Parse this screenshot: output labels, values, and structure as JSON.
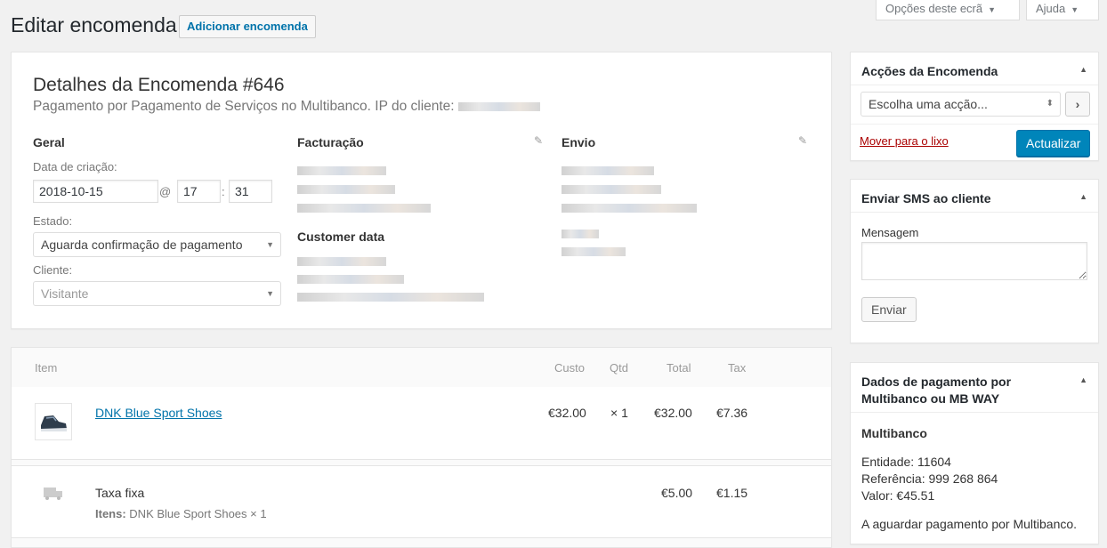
{
  "header": {
    "screen_options": "Opções deste ecrã",
    "help": "Ajuda",
    "title": "Editar encomenda",
    "add_new": "Adicionar encomenda"
  },
  "order": {
    "title": "Detalhes da Encomenda #646",
    "subtitle": "Pagamento por Pagamento de Serviços no Multibanco. IP do cliente:",
    "general": {
      "heading": "Geral",
      "date_label": "Data de criação:",
      "date": "2018-10-15",
      "at": "@",
      "hour": "17",
      "colon": ":",
      "minute": "31",
      "status_label": "Estado:",
      "status": "Aguarda confirmação de pagamento",
      "customer_label": "Cliente:",
      "customer": "Visitante"
    },
    "billing": {
      "heading": "Facturação",
      "customer_data_heading": "Customer data"
    },
    "shipping": {
      "heading": "Envio"
    }
  },
  "items": {
    "headers": {
      "item": "Item",
      "cost": "Custo",
      "qty": "Qtd",
      "total": "Total",
      "tax": "Tax"
    },
    "product": {
      "name": "DNK Blue Sport Shoes",
      "cost": "€32.00",
      "qty": "× 1",
      "total": "€32.00",
      "tax": "€7.36"
    },
    "shipping": {
      "name": "Taxa fixa",
      "items_label": "Itens:",
      "items_value": "DNK Blue Sport Shoes × 1",
      "total": "€5.00",
      "tax": "€1.15"
    }
  },
  "sidebar": {
    "actions": {
      "title": "Acções da Encomenda",
      "select": "Escolha uma acção...",
      "go": "›",
      "trash": "Mover para o lixo",
      "update": "Actualizar"
    },
    "sms": {
      "title": "Enviar SMS ao cliente",
      "message_label": "Mensagem",
      "send": "Enviar"
    },
    "payment": {
      "title": "Dados de pagamento por Multibanco ou MB WAY",
      "method": "Multibanco",
      "entity": "Entidade: 11604",
      "reference": "Referência: 999 268 864",
      "value": "Valor: €45.51",
      "status": "A aguardar pagamento por Multibanco."
    }
  },
  "colors": {
    "primary": "#0085ba",
    "link": "#0073aa",
    "trash": "#aa0000"
  },
  "icons": {
    "toggle": "triangle-up-icon",
    "edit": "pencil-icon",
    "dropdown": "chevron-down-icon",
    "shipping": "truck-icon"
  }
}
